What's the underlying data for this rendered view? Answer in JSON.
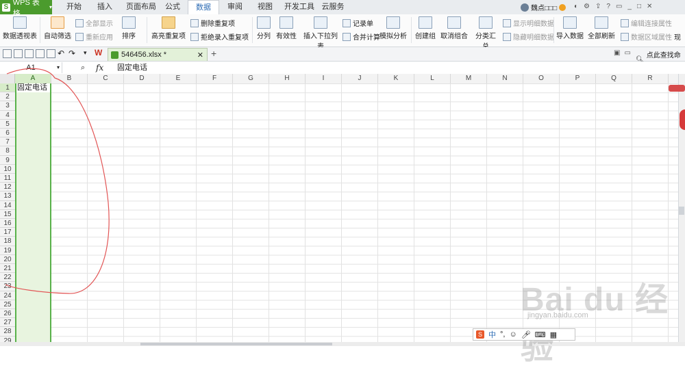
{
  "app": {
    "name": "WPS 表格",
    "logo_letter": "S"
  },
  "menu_tabs": [
    "开始",
    "插入",
    "页面布局",
    "公式",
    "数据",
    "审阅",
    "视图",
    "开发工具",
    "云服务"
  ],
  "active_tab": "数据",
  "user": {
    "name": "魏点□□□"
  },
  "ribbon": {
    "pivot": "数据透视表",
    "autofilter": "自动筛选",
    "show_all": "全部显示",
    "reapply": "重新应用",
    "sort": "排序",
    "highlight_dup": "高亮重复项",
    "remove_dup": "删除重复项",
    "reject_dup": "拒绝录入重复项",
    "split": "分列",
    "validity": "有效性",
    "dropdown": "插入下拉列表",
    "record": "记录单",
    "merge_calc": "合并计算",
    "simulate": "模拟分析",
    "group": "创建组",
    "ungroup": "取消组合",
    "subtotal": "分类汇总",
    "show_detail": "显示明细数据",
    "hide_detail": "隐藏明细数据",
    "import": "导入数据",
    "refresh_all": "全部刷新",
    "edit_link": "编辑连接属性",
    "range_prop": "数据区域属性",
    "more": "现"
  },
  "doc_tab": {
    "filename": "546456.xlsx *"
  },
  "search": {
    "label": "点此查找命令"
  },
  "formula_bar": {
    "name_box": "A1",
    "fx": "fx",
    "value": "固定电话"
  },
  "columns": [
    "A",
    "B",
    "C",
    "D",
    "E",
    "F",
    "G",
    "H",
    "I",
    "J",
    "K",
    "L",
    "M",
    "N",
    "O",
    "P",
    "Q",
    "R"
  ],
  "rows": [
    "1",
    "2",
    "3",
    "4",
    "5",
    "6",
    "7",
    "8",
    "9",
    "10",
    "11",
    "12",
    "13",
    "14",
    "15",
    "16",
    "17",
    "18",
    "19",
    "20",
    "21",
    "22",
    "23",
    "24",
    "25",
    "26",
    "27",
    "28",
    "29"
  ],
  "cells": {
    "A1": "固定电话"
  },
  "watermark": {
    "text": "Bai du 经验",
    "url": "jingyan.baidu.com"
  },
  "ime": {
    "label": "中"
  },
  "colors": {
    "accent_green": "#4b9b2d",
    "selection_green": "#58b14a",
    "annotation_red": "#e25555"
  }
}
